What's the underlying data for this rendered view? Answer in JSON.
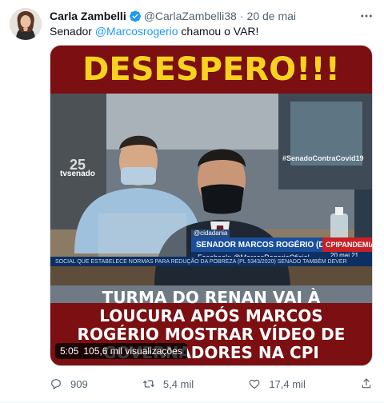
{
  "author": {
    "display_name": "Carla Zambelli",
    "handle": "@CarlaZambelli38",
    "separator": "·",
    "date": "20 de mai",
    "verified_icon": "verified-badge-icon"
  },
  "tweet": {
    "text_before": "Senador ",
    "mention": "@Marcosrogerio",
    "text_after": " chamou o VAR!"
  },
  "media": {
    "headline_top": "DESESPERO!!!",
    "headline_bottom": [
      "TURMA DO RENAN VAI À",
      "LOUCURA APÓS MARCOS",
      "ROGÉRIO MOSTRAR VÍDEO DE",
      "GOVERNADORES NA CPI"
    ],
    "duration": "5:05",
    "views": "105,6 mil visualizações",
    "lower_third_name": "SENADOR MARCOS ROGÉRIO (DEM-RO)",
    "lower_third_fb": "Facebook: @MarcosRogerioOficial",
    "lower_third_tag": "CPIPANDEMIA",
    "cidadania": "@cidadania",
    "date_stamp": "20 mai 21",
    "ticker": "SOCIAL QUE ESTABELECE NORMAS PARA REDUÇÃO DA POBREZA (PL 5343/2020)     SENADO TAMBÉM DEVER",
    "tv_logo": "tvsenado",
    "tv_logo_number": "25",
    "hashtag": "#SenadoContraCovid19"
  },
  "actions": {
    "reply_count": "909",
    "retweet_count": "5,4 mil",
    "like_count": "17,4 mil"
  },
  "colors": {
    "accent": "#1d9bf0",
    "text_secondary": "#536471",
    "banner_red": "#7b0f12",
    "headline_yellow": "#f7d21e"
  }
}
